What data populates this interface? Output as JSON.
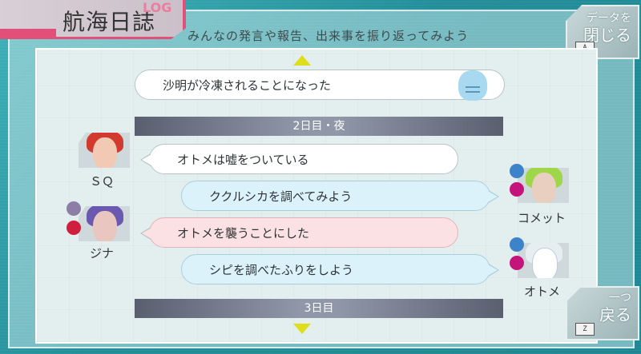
{
  "header": {
    "title": "航海日誌",
    "logo_text": "LOG",
    "subtitle": "みんなの発言や報告、出来事を振り返ってみよう"
  },
  "buttons": {
    "close": {
      "label_line1": "データを",
      "label_line2": "閉じる",
      "key": "A"
    },
    "back": {
      "label_line1": "一つ",
      "label_line2": "戻る",
      "key": "Z"
    }
  },
  "log": {
    "entry0": {
      "text": "沙明が冷凍されることになった",
      "style": "white"
    },
    "divider1": "2日目・夜",
    "entry1": {
      "speaker": "ＳＱ",
      "text": "オトメは嘘をついている",
      "style": "white"
    },
    "entry2": {
      "speaker": "コメット",
      "text": "ククルシカを調べてみよう",
      "style": "blue"
    },
    "entry3": {
      "speaker": "ジナ",
      "text": "オトメを襲うことにした",
      "style": "pink"
    },
    "entry4": {
      "speaker": "オトメ",
      "text": "シピを調べたふりをしよう",
      "style": "blue"
    },
    "divider2": "3日目"
  },
  "colors": {
    "background": "#2a9aa5",
    "accent_pink": "#e24f78",
    "arrow_yellow": "#dede1a",
    "divider": "#6f7485"
  },
  "icons": {
    "scroll_up": "triangle-up-icon",
    "scroll_down": "triangle-down-icon",
    "sleep_face": "frozen-face-icon",
    "role_engineer": "engineer-icon",
    "role_gnosia": "gnosia-icon",
    "role_ac": "ac-follower-icon"
  }
}
